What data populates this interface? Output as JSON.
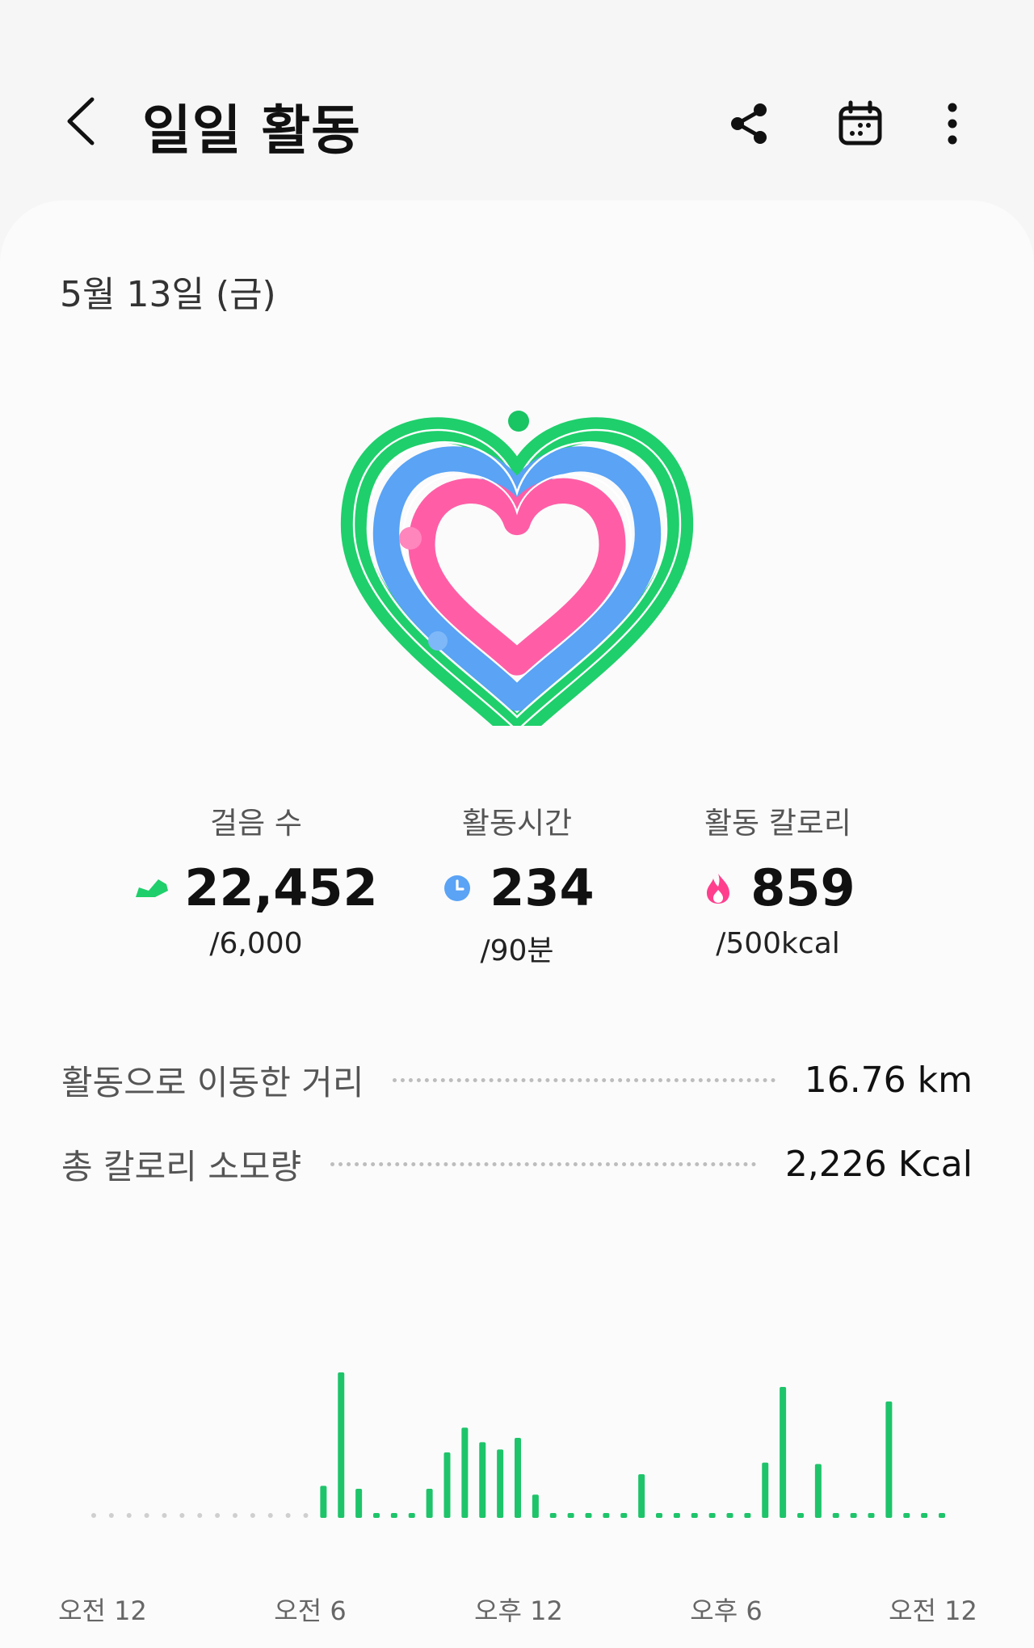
{
  "header": {
    "title": "일일 활동",
    "icons": [
      "back-icon",
      "share-icon",
      "calendar-icon",
      "more-icon"
    ]
  },
  "date": "5월 13일 (금)",
  "colors": {
    "steps": "#1fcf6b",
    "active_time": "#5aa3f5",
    "calories": "#ff5ea6",
    "bar": "#1ec46a"
  },
  "stats": [
    {
      "label": "걸음 수",
      "value": "22,452",
      "goal": "/6,000",
      "icon": "shoe-icon"
    },
    {
      "label": "활동시간",
      "value": "234",
      "goal": "/90분",
      "icon": "clock-icon"
    },
    {
      "label": "활동 칼로리",
      "value": "859",
      "goal": "/500kcal",
      "icon": "flame-icon"
    }
  ],
  "details": [
    {
      "label": "활동으로 이동한 거리",
      "value": "16.76 km"
    },
    {
      "label": "총 칼로리 소모량",
      "value": "2,226 Kcal"
    }
  ],
  "chart_data": {
    "type": "bar",
    "x_labels": [
      "오전 12",
      "오전 6",
      "오후 12",
      "오후 6",
      "오전 12"
    ],
    "slots": 49,
    "values": [
      0,
      0,
      0,
      0,
      0,
      0,
      0,
      0,
      0,
      0,
      0,
      0,
      0,
      22,
      100,
      20,
      2,
      2,
      2,
      20,
      45,
      62,
      52,
      47,
      55,
      16,
      2,
      2,
      2,
      2,
      3,
      30,
      2,
      2,
      2,
      2,
      2,
      2,
      38,
      90,
      2,
      37,
      2,
      2,
      2,
      80,
      2,
      2,
      2
    ]
  }
}
